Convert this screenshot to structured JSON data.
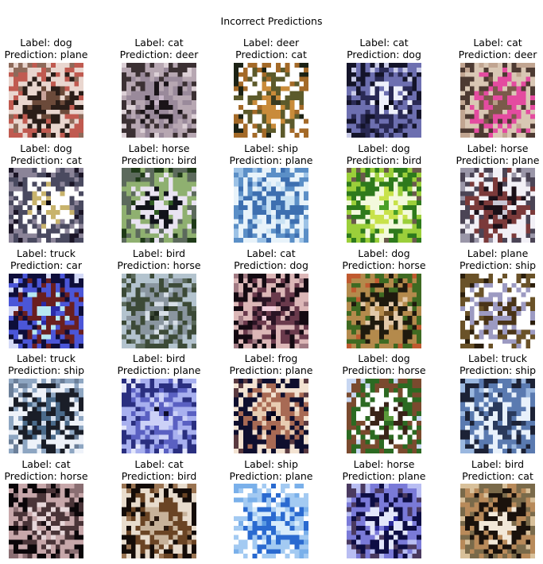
{
  "title": "Incorrect Predictions",
  "items": [
    {
      "label": "Label: dog",
      "prediction": "Prediction: plane",
      "colors": [
        "#c9a39a",
        "#6b4a3a",
        "#2a1d18",
        "#e9d6cf",
        "#c05a50",
        "#8e6a5a"
      ]
    },
    {
      "label": "Label: cat",
      "prediction": "Prediction: deer",
      "colors": [
        "#c8b6c9",
        "#1a1418",
        "#9a8a9b",
        "#b7a7b2",
        "#3b3033",
        "#dcd0d6"
      ]
    },
    {
      "label": "Label: deer",
      "prediction": "Prediction: cat",
      "colors": [
        "#3a3a1f",
        "#c98b3a",
        "#5c5a2b",
        "#ffffff",
        "#a46a28",
        "#1c2215"
      ]
    },
    {
      "label": "Label: cat",
      "prediction": "Prediction: dog",
      "colors": [
        "#0b0b19",
        "#eef0fb",
        "#2a2a55",
        "#6d6fb0",
        "#14142a",
        "#c9cbe8"
      ]
    },
    {
      "label": "Label: cat",
      "prediction": "Prediction: deer",
      "colors": [
        "#b79c86",
        "#7a5a4a",
        "#e44ba0",
        "#d9c7b4",
        "#4d3a32",
        "#c1a591"
      ]
    },
    {
      "label": "Label: dog",
      "prediction": "Prediction: cat",
      "colors": [
        "#0d0a12",
        "#c8b36c",
        "#ffffff",
        "#4a4a60",
        "#8b8498",
        "#1b1526"
      ]
    },
    {
      "label": "Label: horse",
      "prediction": "Prediction: bird",
      "colors": [
        "#2f5a22",
        "#11131a",
        "#e9e3f1",
        "#8fb070",
        "#5c6a5c",
        "#1f3a18"
      ]
    },
    {
      "label": "Label: ship",
      "prediction": "Prediction: plane",
      "colors": [
        "#79a7d6",
        "#c9e2f4",
        "#3d6fb0",
        "#e8f3fa",
        "#5b8fc7",
        "#9cc2e6"
      ]
    },
    {
      "label": "Label: dog",
      "prediction": "Prediction: bird",
      "colors": [
        "#4aa028",
        "#c8e24a",
        "#f3f9dc",
        "#2e7a1c",
        "#9bcf3a",
        "#6a5a4c"
      ]
    },
    {
      "label": "Label: horse",
      "prediction": "Prediction: plane",
      "colors": [
        "#c9c7d4",
        "#1b1018",
        "#7b3a3a",
        "#f2f0f6",
        "#4b4455",
        "#9a96a8"
      ]
    },
    {
      "label": "Label: truck",
      "prediction": "Prediction: car",
      "colors": [
        "#2a2aa8",
        "#b7e8f2",
        "#6a1f1f",
        "#4b56d8",
        "#0e0e3a",
        "#d3d9f7"
      ]
    },
    {
      "label": "Label: bird",
      "prediction": "Prediction: horse",
      "colors": [
        "#1f2a1c",
        "#d7dfe7",
        "#8a96a0",
        "#3c4a37",
        "#b3c3ce",
        "#5b6a5c"
      ]
    },
    {
      "label": "Label: cat",
      "prediction": "Prediction: dog",
      "colors": [
        "#f2d0dd",
        "#2a1424",
        "#6a3a4c",
        "#dcb7b7",
        "#140a12",
        "#a17a83"
      ]
    },
    {
      "label": "Label: dog",
      "prediction": "Prediction: horse",
      "colors": [
        "#6a4a20",
        "#e2c8a8",
        "#1f1a0e",
        "#b48a4c",
        "#3f6a22",
        "#c05a30"
      ]
    },
    {
      "label": "Label: plane",
      "prediction": "Prediction: ship",
      "colors": [
        "#e7e4f2",
        "#4a3418",
        "#9c9ac2",
        "#ffffff",
        "#6a5228",
        "#2b1e0c"
      ]
    },
    {
      "label": "Label: truck",
      "prediction": "Prediction: ship",
      "colors": [
        "#d3ddec",
        "#4a6a8a",
        "#1a1e28",
        "#eef2f9",
        "#8ea6c2",
        "#6b7f99"
      ]
    },
    {
      "label": "Label: bird",
      "prediction": "Prediction: plane",
      "colors": [
        "#0c0c2a",
        "#ccd1f7",
        "#5a60c2",
        "#a8b0ef",
        "#2a2f80",
        "#e4e7fb"
      ]
    },
    {
      "label": "Label: frog",
      "prediction": "Prediction: plane",
      "colors": [
        "#02021a",
        "#e8cdb2",
        "#a86a54",
        "#0f0f2e",
        "#f3e3d2",
        "#5a3a40"
      ]
    },
    {
      "label": "Label: dog",
      "prediction": "Prediction: horse",
      "colors": [
        "#5a9a3a",
        "#3a2418",
        "#ffffff",
        "#2c6a22",
        "#7a4a2e",
        "#c8d7f2"
      ]
    },
    {
      "label": "Label: truck",
      "prediction": "Prediction: ship",
      "colors": [
        "#c7ddf4",
        "#2a3a5c",
        "#e8f1fb",
        "#5a7ab0",
        "#1c2236",
        "#9ab7df"
      ]
    },
    {
      "label": "Label: cat",
      "prediction": "Prediction: horse",
      "colors": [
        "#1a0f14",
        "#e6d6d9",
        "#4a3438",
        "#c7a7aa",
        "#0b0609",
        "#8a6e72"
      ]
    },
    {
      "label": "Label: cat",
      "prediction": "Prediction: bird",
      "colors": [
        "#2a1a10",
        "#c7b29a",
        "#6a4424",
        "#e8dccd",
        "#140c08",
        "#9a7452"
      ]
    },
    {
      "label": "Label: ship",
      "prediction": "Prediction: plane",
      "colors": [
        "#5a9ae2",
        "#d8ecfb",
        "#2a6ad0",
        "#a3caf2",
        "#ffffff",
        "#7ab0ea"
      ]
    },
    {
      "label": "Label: horse",
      "prediction": "Prediction: plane",
      "colors": [
        "#2a2a9a",
        "#e2e6fb",
        "#0e0e44",
        "#7a7ad8",
        "#4a3a60",
        "#b8bdf2"
      ]
    },
    {
      "label": "Label: bird",
      "prediction": "Prediction: cat",
      "colors": [
        "#4a3a2a",
        "#f2e8d8",
        "#1a120c",
        "#b88a5a",
        "#7a6a4a",
        "#d8c09a"
      ]
    }
  ]
}
